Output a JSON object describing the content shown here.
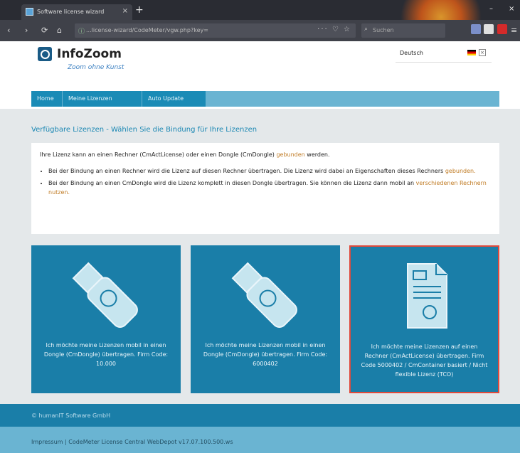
{
  "browser": {
    "tab_title": "Software license wizard",
    "tab_close": "×",
    "new_tab": "+",
    "url": "...license-wizard/CodeMeter/vgw.php?key=",
    "url_tools": "··· ♡ ☆",
    "search_placeholder": "Suchen",
    "nav_back": "‹",
    "nav_forward": "›",
    "nav_reload": "⟳",
    "nav_home": "⌂",
    "win_min": "–",
    "win_close": "×"
  },
  "header": {
    "logo_title": "InfoZoom",
    "logo_slogan": "Zoom ohne Kunst",
    "language": "Deutsch",
    "lang_close": "×"
  },
  "mainnav": {
    "items": [
      {
        "label": "Home"
      },
      {
        "label": "Meine Lizenzen"
      },
      {
        "label": "Auto Update"
      }
    ]
  },
  "content": {
    "heading": "Verfügbare Lizenzen - Wählen Sie die Bindung für Ihre Lizenzen",
    "intro_a": "Ihre Lizenz kann an einen Rechner (CmActLicense) oder einen Dongle (CmDongle)",
    "intro_hl": " gebunden",
    "intro_b": " werden.",
    "bullet1_a": "Bei der Bindung an einen Rechner wird die Lizenz auf diesen Rechner übertragen. Die Lizenz wird dabei an Eigenschaften dieses Rechners",
    "bullet1_hl": " gebunden.",
    "bullet2_a": "Bei der Bindung an einen CmDongle wird die Lizenz komplett in diesen Dongle übertragen. Sie können die Lizenz dann mobil an",
    "bullet2_hl": " verschiedenen Rechnern nutzen."
  },
  "cards": [
    {
      "text": "Ich möchte meine Lizenzen mobil in einen Dongle (CmDongle) übertragen. Firm Code: 10.000"
    },
    {
      "text": "Ich möchte meine Lizenzen mobil in einen Dongle (CmDongle) übertragen. Firm Code: 6000402"
    },
    {
      "text": "Ich möchte meine Lizenzen auf einen Rechner (CmActLicense) übertragen. Firm Code 5000402 / CmContainer basiert / Nicht flexible Lizenz (TCO)"
    }
  ],
  "footer": {
    "copyright": "© humanIT Software GmbH",
    "links": "Impressum | CodeMeter License Central WebDepot v17.07.100.500.ws"
  }
}
